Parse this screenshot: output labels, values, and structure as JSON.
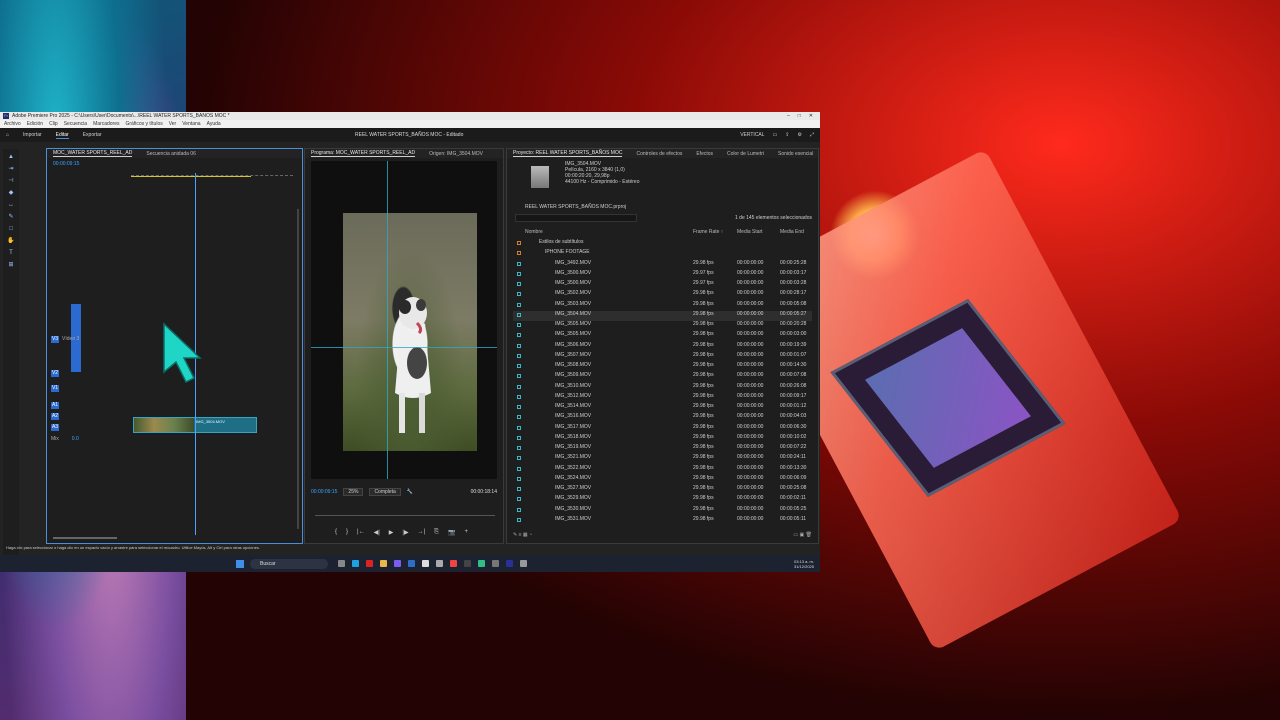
{
  "window": {
    "title": "Adobe Premiere Pro 2025 - C:\\Users\\User\\Documents\\...\\REEL WATER SPORTS_BAÑOS MOC *",
    "controls": [
      "–",
      "□",
      "✕"
    ]
  },
  "menu": [
    "Archivo",
    "Edición",
    "Clip",
    "Secuencia",
    "Marcadores",
    "Gráficos y títulos",
    "Ver",
    "Ventana",
    "Ayuda"
  ],
  "workspace_tabs": [
    "Importar",
    "Editar",
    "Exportar"
  ],
  "workspace_selected": "Editar",
  "document_title": "REEL WATER SPORTS_BAÑOS MOC - Editado",
  "layout_label": "VERTICAL",
  "timeline": {
    "tabs": [
      "MOC_WATER SPORTS_REEL_AD",
      "Secuencia anidada 06"
    ],
    "timecode": "00:00:09:15",
    "tracks": [
      {
        "id": "V3",
        "label": "Vídeo 3"
      },
      {
        "id": "V2",
        "label": ""
      },
      {
        "id": "V1",
        "label": ""
      },
      {
        "id": "A1",
        "label": ""
      },
      {
        "id": "A2",
        "label": ""
      },
      {
        "id": "A3",
        "label": ""
      },
      {
        "id": "Mix",
        "label": "Mezcla"
      }
    ],
    "mix_value": "0.0",
    "clip_name": "IMG_3504.MOV"
  },
  "program": {
    "tabs": [
      "Programa: MOC_WATER SPORTS_REEL_AD",
      "Origen: IMG_3504.MOV"
    ],
    "timecode_left": "00:00:09:15",
    "zoom": "25%",
    "quality": "Completa",
    "timecode_right": "00:00:18:14",
    "transport": [
      "{",
      "}",
      "|←",
      "◀|",
      "▶",
      "|▶",
      "→|",
      "⎘",
      "📷",
      "+"
    ]
  },
  "project": {
    "tabs": [
      "Proyecto: REEL WATER SPORTS_BAÑOS MOC",
      "Controles de efectos",
      "Efectos",
      "Color de Lumetri",
      "Sonido esencial"
    ],
    "preview_name": "IMG_3504.MOV",
    "preview_lines": [
      "Película, 2160 x 3840 (1,0)",
      "00:00:20:20, 29,98p",
      "44100 Hz - Comprimido - Estéreo"
    ],
    "project_file": "REEL WATER SPORTS_BAÑOS MOC.prproj",
    "selection_count": "1 de 145 elementos seleccionados",
    "columns": [
      "Nombre",
      "Frame Rate ↑",
      "Media Start",
      "Media End"
    ],
    "folders": [
      "Estilos de subtítulos",
      "IPHONE FOOTAGE"
    ],
    "items": [
      {
        "name": "IMG_3492.MOV",
        "fps": "29.98 fps",
        "start": "00:00:00:00",
        "end": "00:00:25:28"
      },
      {
        "name": "IMG_3500.MOV",
        "fps": "29.97 fps",
        "start": "00:00:00:00",
        "end": "00:00:03:17"
      },
      {
        "name": "IMG_3500.MOV",
        "fps": "29.97 fps",
        "start": "00:00:00:00",
        "end": "00:00:03:28"
      },
      {
        "name": "IMG_3502.MOV",
        "fps": "29.98 fps",
        "start": "00:00:00:00",
        "end": "00:00:28:17"
      },
      {
        "name": "IMG_3503.MOV",
        "fps": "29.98 fps",
        "start": "00:00:00:00",
        "end": "00:00:05:08"
      },
      {
        "name": "IMG_3504.MOV",
        "fps": "29.98 fps",
        "start": "00:00:00:00",
        "end": "00:00:05:27"
      },
      {
        "name": "IMG_3505.MOV",
        "fps": "29.98 fps",
        "start": "00:00:00:00",
        "end": "00:00:20:28"
      },
      {
        "name": "IMG_3505.MOV",
        "fps": "29.98 fps",
        "start": "00:00:00:00",
        "end": "00:00:03:00"
      },
      {
        "name": "IMG_3506.MOV",
        "fps": "29.98 fps",
        "start": "00:00:00:00",
        "end": "00:00:19:39"
      },
      {
        "name": "IMG_3507.MOV",
        "fps": "29.98 fps",
        "start": "00:00:00:00",
        "end": "00:00:01:07"
      },
      {
        "name": "IMG_3508.MOV",
        "fps": "29.98 fps",
        "start": "00:00:00:00",
        "end": "00:00:14:30"
      },
      {
        "name": "IMG_3509.MOV",
        "fps": "29.98 fps",
        "start": "00:00:00:00",
        "end": "00:00:07:08"
      },
      {
        "name": "IMG_3510.MOV",
        "fps": "29.98 fps",
        "start": "00:00:00:00",
        "end": "00:00:26:08"
      },
      {
        "name": "IMG_3512.MOV",
        "fps": "29.98 fps",
        "start": "00:00:00:00",
        "end": "00:00:09:17"
      },
      {
        "name": "IMG_3514.MOV",
        "fps": "29.98 fps",
        "start": "00:00:00:00",
        "end": "00:00:01:12"
      },
      {
        "name": "IMG_3516.MOV",
        "fps": "29.98 fps",
        "start": "00:00:00:00",
        "end": "00:00:04:03"
      },
      {
        "name": "IMG_3517.MOV",
        "fps": "29.98 fps",
        "start": "00:00:00:00",
        "end": "00:00:06:30"
      },
      {
        "name": "IMG_3518.MOV",
        "fps": "29.98 fps",
        "start": "00:00:00:00",
        "end": "00:00:10:02"
      },
      {
        "name": "IMG_3519.MOV",
        "fps": "29.98 fps",
        "start": "00:00:00:00",
        "end": "00:00:07:22"
      },
      {
        "name": "IMG_3521.MOV",
        "fps": "29.98 fps",
        "start": "00:00:00:00",
        "end": "00:00:24:11"
      },
      {
        "name": "IMG_3522.MOV",
        "fps": "29.98 fps",
        "start": "00:00:00:00",
        "end": "00:00:13:30"
      },
      {
        "name": "IMG_3524.MOV",
        "fps": "29.98 fps",
        "start": "00:00:00:00",
        "end": "00:00:06:09"
      },
      {
        "name": "IMG_3527.MOV",
        "fps": "29.98 fps",
        "start": "00:00:00:00",
        "end": "00:00:25:08"
      },
      {
        "name": "IMG_3529.MOV",
        "fps": "29.98 fps",
        "start": "00:00:00:00",
        "end": "00:00:02:11"
      },
      {
        "name": "IMG_3530.MOV",
        "fps": "29.98 fps",
        "start": "00:00:00:00",
        "end": "00:00:05:25"
      },
      {
        "name": "IMG_3531.MOV",
        "fps": "29.98 fps",
        "start": "00:00:00:00",
        "end": "00:00:05:11"
      }
    ]
  },
  "status_text": "Haga clic para seleccionar o haga clic en un espacio vacío y arrastre para seleccionar el recuadro. Utilice Mayús, Alt y Ctrl para otras opciones.",
  "taskbar": {
    "search_label": "Buscar",
    "time": "03:13 a. m.",
    "date": "31/12/2025"
  },
  "colors": {
    "accent": "#3aa6ff",
    "cursor": "#1fd6c6",
    "clip": "#1e6f86"
  }
}
